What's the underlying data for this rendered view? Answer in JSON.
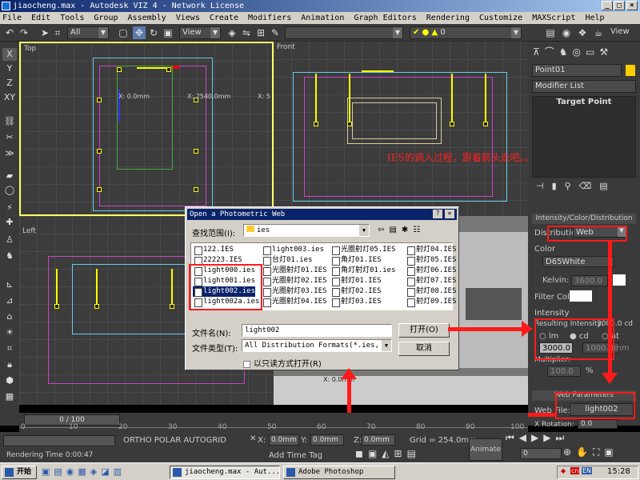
{
  "window": {
    "title": "jiaocheng.max - Autodesk VIZ 4 - Network License"
  },
  "menu": [
    "File",
    "Edit",
    "Tools",
    "Group",
    "Assembly",
    "Views",
    "Create",
    "Modifiers",
    "Animation",
    "Graph Editors",
    "Rendering",
    "Customize",
    "MAXScript",
    "Help"
  ],
  "toolbar": {
    "selection_filter": "All",
    "ref_coord": "View",
    "layer_value": "0",
    "view_right": "View"
  },
  "left_toolbar": [
    "X",
    "Y",
    "Z",
    "XY"
  ],
  "viewports": {
    "top": {
      "label": "Top",
      "x0": "X: 0.0mm",
      "x2": "X: 2540.0mm",
      "x5": "X: 5"
    },
    "front": {
      "label": "Front"
    },
    "left": {
      "label": "Left"
    },
    "perspective_text": "X: 0.0mm"
  },
  "annotation": "IES的调入过程，跟着箭头走吧。。。。！",
  "dialog": {
    "title": "Open a Photometric Web",
    "look_in_label": "查找范围(I):",
    "look_in_value": "ies",
    "files": {
      "col1": [
        "122.IES",
        "22223.IES",
        "light000.ies",
        "light001.ies",
        "light002.ies",
        "light002a.ies"
      ],
      "col2": [
        "light003.ies",
        "台灯01.ies",
        "光圈射灯01.IES",
        "光圈射灯02.IES",
        "光圈射灯03.IES",
        "光圈射灯04.IES"
      ],
      "col3": [
        "光圈射灯05.IES",
        "角灯01.IES",
        "角灯射灯01.ies",
        "射灯01.IES",
        "射灯02.IES",
        "射灯03.IES"
      ],
      "col4": [
        "射灯04.IES",
        "射灯05.IES",
        "射灯06.IES",
        "射灯07.IES",
        "射灯08.IES",
        "射灯09.IES"
      ]
    },
    "filename_label": "文件名(N):",
    "filename_value": "light002",
    "filetype_label": "文件类型(T):",
    "filetype_value": "All Distribution Formats(*.ies, *.ci",
    "readonly_label": "以只读方式打开(R)",
    "open_button": "打开(O)",
    "cancel_button": "取消"
  },
  "rpanel": {
    "object_name": "Point01",
    "modifier_list": "Modifier List",
    "target_point": "Target Point",
    "intensity_section": "Intensity/Color/Distribution",
    "distribution_label": "Distribution:",
    "distribution_value": "Web",
    "color_label": "Color",
    "color_value": "D65White",
    "kelvin_label": "Kelvin:",
    "kelvin_value": "3600.0",
    "filter_label": "Filter Color:",
    "intensity_label": "Intensity",
    "resulting_label": "Resulting Intensity:",
    "resulting_value": "3000.0 cd",
    "lm_label": "lm",
    "cd_label": "cd",
    "at_label": "at",
    "intensity_value": "3000.0",
    "at_value": "1000.0mm",
    "multiplier_label": "Multiplier:",
    "multiplier_value": "100.0",
    "percent": "%",
    "web_section": "Web Parameters",
    "web_file_label": "Web File:",
    "web_file_value": "light002",
    "xrot_label": "X Rotation:",
    "xrot_value": "0.0"
  },
  "timeline": {
    "frame": "0 / 100",
    "ticks": [
      "0",
      "10",
      "20",
      "30",
      "40",
      "50",
      "60",
      "70",
      "80",
      "90",
      "100"
    ]
  },
  "status": {
    "rendering_time": "Rendering Time  0:00:47",
    "snaps": "ORTHO  POLAR  AUTOGRID",
    "x_label": "X:",
    "x_value": "0.0mm",
    "y_label": "Y:",
    "y_value": "0.0mm",
    "z_label": "Z:",
    "z_value": "0.0mm",
    "grid": "Grid = 254.0mm",
    "add_time_tag": "Add Time Tag",
    "animate": "Animate",
    "frame_field": "0"
  },
  "taskbar": {
    "start": "开始",
    "task1": "jiaocheng.max - Aut...",
    "task2": "Adobe Photoshop",
    "clock": "15:28",
    "lang": "EN"
  },
  "colors": {
    "annotation": "#ff2020",
    "arrow": "#ff1a1a",
    "light_yellow": "#ffff00"
  }
}
